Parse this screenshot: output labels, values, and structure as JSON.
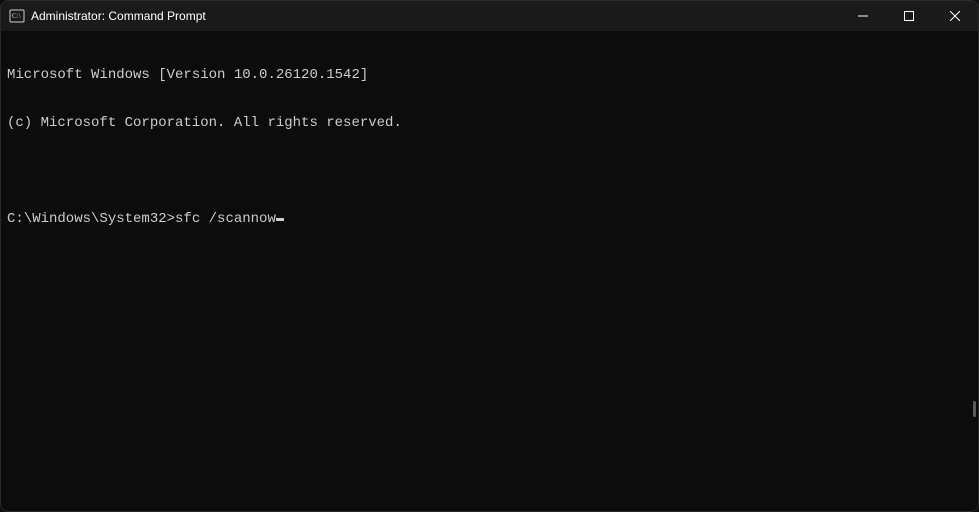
{
  "titlebar": {
    "title": "Administrator: Command Prompt"
  },
  "terminal": {
    "line1": "Microsoft Windows [Version 10.0.26120.1542]",
    "line2": "(c) Microsoft Corporation. All rights reserved.",
    "blank1": "",
    "prompt": "C:\\Windows\\System32>",
    "command": "sfc /scannow"
  }
}
